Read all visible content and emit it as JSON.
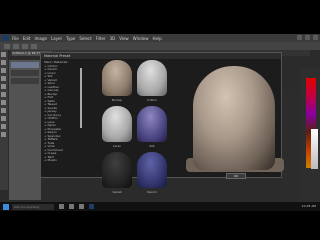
{
  "app": {
    "menus": [
      "PS",
      "File",
      "Edit",
      "Image",
      "Layer",
      "Type",
      "Select",
      "Filter",
      "3D",
      "View",
      "Window",
      "Help"
    ],
    "document_tab": "Untitled-1 @ 66.7%"
  },
  "dialog": {
    "title": "Material Preset",
    "tree": [
      "Fabric Materials",
      "+ Cotton",
      "+ Denim",
      "+ Linen",
      "+ Silk",
      "+ Velvet",
      "+ Wool",
      "+ Leather",
      "+ Canvas",
      "+ Burlap",
      "+ Felt",
      "+ Satin",
      "+ Tweed",
      "+ Suede",
      "+ Jersey",
      "+ Corduroy",
      "+ Chiffon",
      "+ Lace",
      "+ Nylon",
      "+ Polyester",
      "+ Rayon",
      "+ Spandex",
      "+ Taffeta",
      "+ Tulle",
      "+ Voile",
      "+ Combined",
      "+ Crepe",
      "+ Twill",
      "+ Muslin"
    ],
    "thumbs": [
      {
        "label": "Burlap"
      },
      {
        "label": "Cotton"
      },
      {
        "label": "Linen"
      },
      {
        "label": "Silk"
      },
      {
        "label": "Velvet"
      },
      {
        "label": "Denim"
      }
    ],
    "ok_label": "OK"
  },
  "taskbar": {
    "search_placeholder": "Ask me anything",
    "clock": "10:25 AM"
  }
}
